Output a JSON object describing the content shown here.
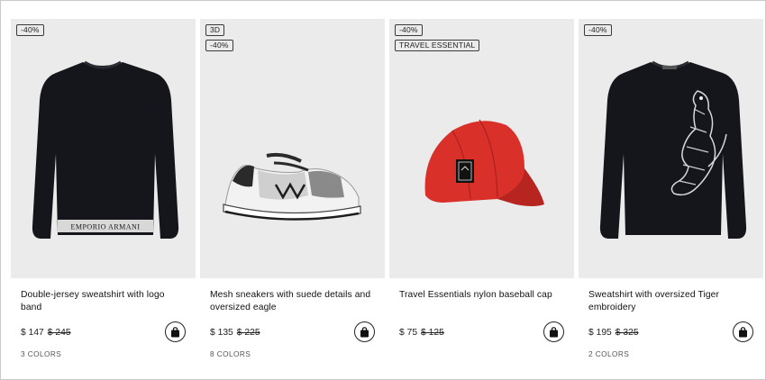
{
  "products": [
    {
      "badges": [
        "-40%"
      ],
      "title": "Double-jersey sweatshirt with logo band",
      "price": "$ 147",
      "old_price": "$ 245",
      "colors": "3 COLORS",
      "image": "black-sweatshirt-logo-band"
    },
    {
      "badges": [
        "3D",
        "-40%"
      ],
      "title": "Mesh sneakers with suede details and oversized eagle",
      "price": "$ 135",
      "old_price": "$ 225",
      "colors": "8 COLORS",
      "image": "grey-white-mesh-sneaker"
    },
    {
      "badges": [
        "-40%",
        "TRAVEL ESSENTIAL"
      ],
      "title": "Travel Essentials nylon baseball cap",
      "price": "$ 75",
      "old_price": "$ 125",
      "colors": "",
      "image": "red-baseball-cap"
    },
    {
      "badges": [
        "-40%"
      ],
      "title": "Sweatshirt with oversized Tiger embroidery",
      "price": "$ 195",
      "old_price": "$ 325",
      "colors": "2 COLORS",
      "image": "black-sweatshirt-tiger"
    }
  ],
  "bag_icon": "shopping-bag-icon",
  "colors_theme": {
    "image_bg": "#ebebeb",
    "cap_red": "#d9302a",
    "sweatshirt": "#15161b"
  }
}
